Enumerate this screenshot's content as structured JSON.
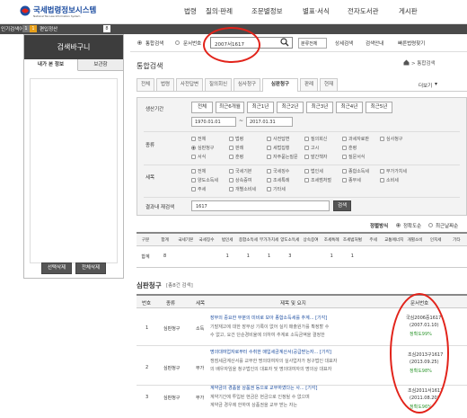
{
  "logo": {
    "title": "국세법령정보시스템",
    "subtitle": "National Tax Law Information System"
  },
  "nav": [
    "법령",
    "질의·판례",
    "조문별정보",
    "별표·서식",
    "전자도서관",
    "게시판"
  ],
  "ranking": {
    "label": "인기검색어",
    "rank": "1",
    "keyword": "편입정산",
    "count": "8"
  },
  "left": {
    "basket_title": "검색바구니",
    "tabs": [
      "내가 본 정보",
      "보관함"
    ],
    "select_delete": "선택삭제",
    "delete_all": "전체삭제"
  },
  "search": {
    "radio1": "통합검색",
    "radio2": "문서번호",
    "value": "2007서1617",
    "sort_select": "분류전체",
    "links": [
      "상세검색",
      "검색안내",
      "빠른법령찾기"
    ]
  },
  "section_title": "통합검색",
  "breadcrumb": "> 통합검색",
  "tabs": [
    "전체",
    "법령",
    "사전답변",
    "질의회신",
    "심사청구",
    "심판청구",
    "판례",
    "현재"
  ],
  "more_label": "더보기",
  "filters": {
    "period_label": "생산기간",
    "period_buttons": [
      "전체",
      "최근6개월",
      "최근1년",
      "최근2년",
      "최근3년",
      "최근4년",
      "최근5년"
    ],
    "date_from": "1970.01.01",
    "date_sep": "~",
    "date_to": "2017.01.31",
    "type_label": "종류",
    "types": [
      "전체",
      "법령",
      "사전답변",
      "질의회신",
      "과세자료판",
      "심사청구",
      "심판청구",
      "판례",
      "세법집행",
      "고시",
      "훈령",
      "서식",
      "훈령",
      "자주묻는질문",
      "발간책자",
      "질문서식"
    ],
    "tax_label": "세목",
    "taxes": [
      "전체",
      "국세기본",
      "국세징수",
      "법인세",
      "종합소득세",
      "부가가치세",
      "양도소득세",
      "상속증여",
      "조세특례",
      "조세범처벌",
      "종부세",
      "소비세",
      "주세",
      "개별소비세",
      "기타세"
    ],
    "refine_label": "결과내 재검색",
    "refine_value": "1617",
    "refine_button": "검색"
  },
  "sort": {
    "label": "정렬방식",
    "option1": "정확도순",
    "option2": "최근날짜순"
  },
  "summary_table": {
    "headers": [
      "구분",
      "합계",
      "국세기본",
      "국세징수",
      "법인세",
      "종합소득세",
      "부가가치세",
      "양도소득세",
      "상속증여",
      "조세특례",
      "조세범처벌",
      "주세",
      "교통에너지",
      "개별소비",
      "인지세",
      "기타"
    ],
    "row": [
      "합계",
      "8",
      "",
      "",
      "1",
      "1",
      "1",
      "3",
      "",
      "1",
      "1",
      "",
      "",
      "",
      "",
      ""
    ]
  },
  "results": {
    "title": "심판청구",
    "count_note": "[총8건 검색]",
    "headers": [
      "번호",
      "종류",
      "세목",
      "제목 및 요지",
      "문서번호"
    ],
    "rows": [
      {
        "no": "1",
        "kind": "심판청구",
        "tax": "소득",
        "title": "장부의 중요한 부분의 미비로 보아 종합소득세를 추계...  [기각]",
        "line1": "기말재고에 대한 장부상 기록이 없어 실지 매출원가를 확정할 수",
        "line2": "수 없고, 요건 단순경비율에 의하여 추계로 소득금액을 결정한",
        "doc": "국심2006중1617",
        "date": "(2007.01.10)",
        "acc": "정확도99%"
      },
      {
        "no": "2",
        "kind": "심판청구",
        "tax": "부가",
        "title": "명의대여업자로부터 수취한 매입세금계산서(공급받는자...  [기각]",
        "line1": "쟁점세금계산서를 교부한 명의대여자의 실사업자가 청구법인 대표자",
        "line2": "의 배우자임을 청구법인의 대표자 및 명의대여자의 명의상 대표자",
        "doc": "조심2013구1617",
        "date": "(2013.09.25)",
        "acc": "정확도98%"
      },
      {
        "no": "3",
        "kind": "심판청구",
        "tax": "부가",
        "title": "계약금의 경품을 상품권 등으로 교부하였다는 사...  [기각]",
        "line1": "계약기간에 투입된 현금은 현금으로 인정될 수 없으며",
        "line2": "계약금 경우에 한하여 상품권을 교부 받는 자는",
        "doc": "조심2011서1617",
        "date": "(2011.08.20)",
        "acc": "정확도96%"
      }
    ]
  },
  "colors": {
    "brand": "#1e4ea1",
    "basket_bg": "#3d3d3d",
    "accent_red": "#e2231a",
    "acc_green": "#339933"
  }
}
